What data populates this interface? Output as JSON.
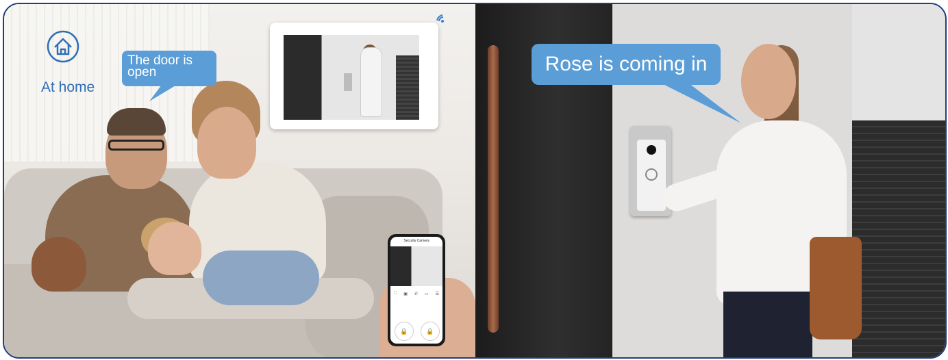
{
  "labels": {
    "home_label": "At home",
    "door_bubble_line1": "The door is",
    "door_bubble_line2": "open",
    "visitor_bubble": "Rose is coming in"
  },
  "phone_app": {
    "title": "Security Camera",
    "lock_icon_1": "🔒",
    "lock_icon_2": "🔒"
  },
  "icons": {
    "home": "house-outline-icon",
    "wifi": "wifi-icon"
  },
  "colors": {
    "accent_blue": "#5b9dd6",
    "frame_border": "#1f3f7a",
    "home_blue": "#2f6fb5"
  }
}
